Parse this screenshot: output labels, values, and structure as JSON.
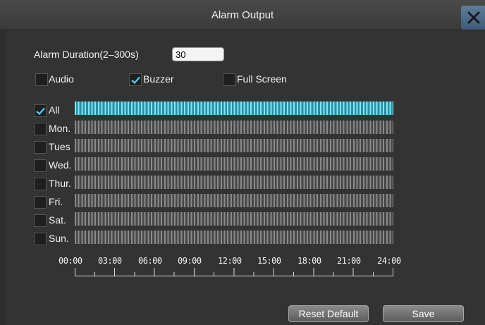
{
  "window": {
    "title": "Alarm Output",
    "close_icon": "close-icon"
  },
  "duration": {
    "label": "Alarm Duration(2–300s)",
    "value": "30"
  },
  "options": [
    {
      "label": "Audio",
      "checked": false
    },
    {
      "label": "Buzzer",
      "checked": true
    },
    {
      "label": "Full Screen",
      "checked": false
    }
  ],
  "schedule": {
    "rows": [
      {
        "label": "All",
        "checked": true
      },
      {
        "label": "Mon.",
        "checked": false
      },
      {
        "label": "Tues",
        "checked": false
      },
      {
        "label": "Wed.",
        "checked": false
      },
      {
        "label": "Thur.",
        "checked": false
      },
      {
        "label": "Fri.",
        "checked": false
      },
      {
        "label": "Sat.",
        "checked": false
      },
      {
        "label": "Sun.",
        "checked": false
      }
    ],
    "time_ticks": [
      "00:00",
      "03:00",
      "06:00",
      "09:00",
      "12:00",
      "15:00",
      "18:00",
      "21:00",
      "24:00"
    ],
    "active_color": "#7fe6f5",
    "inactive_color": "#8a8a8a"
  },
  "buttons": {
    "reset_label": "Reset Default",
    "save_label": "Save"
  }
}
